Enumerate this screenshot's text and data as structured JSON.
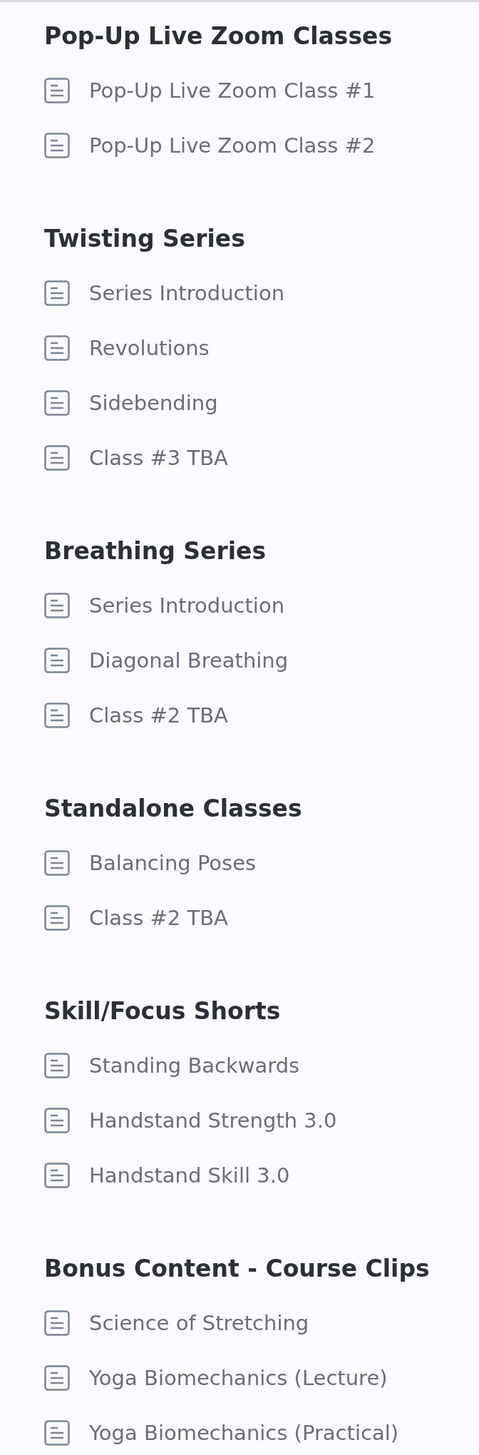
{
  "sections": [
    {
      "title": "Pop-Up Live Zoom Classes",
      "lessons": [
        "Pop-Up Live Zoom Class #1",
        "Pop-Up Live Zoom Class #2"
      ]
    },
    {
      "title": "Twisting Series",
      "lessons": [
        "Series Introduction",
        "Revolutions",
        "Sidebending",
        "Class #3 TBA"
      ]
    },
    {
      "title": "Breathing Series",
      "lessons": [
        "Series Introduction",
        "Diagonal Breathing",
        "Class #2 TBA"
      ]
    },
    {
      "title": "Standalone Classes",
      "lessons": [
        "Balancing Poses",
        "Class #2 TBA"
      ]
    },
    {
      "title": "Skill/Focus Shorts",
      "lessons": [
        "Standing Backwards",
        "Handstand Strength 3.0",
        "Handstand Skill 3.0"
      ]
    },
    {
      "title": "Bonus Content - Course Clips",
      "lessons": [
        "Science of Stretching",
        "Yoga Biomechanics (Lecture)",
        "Yoga Biomechanics (Practical)"
      ]
    }
  ]
}
